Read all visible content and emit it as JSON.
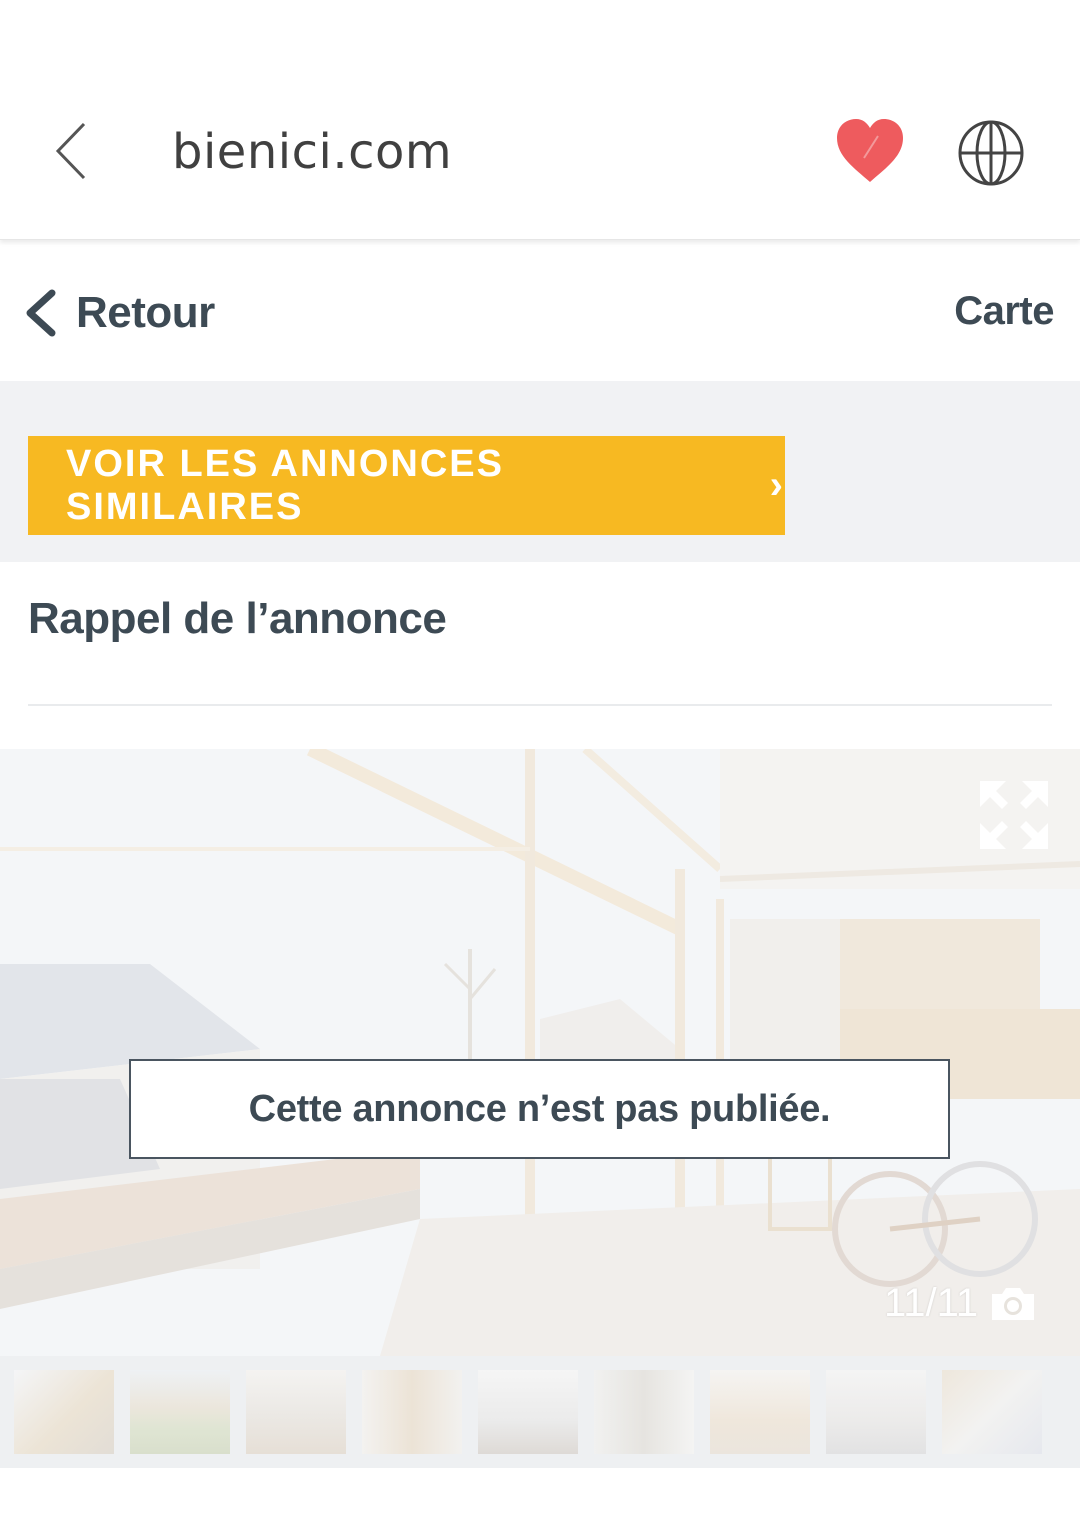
{
  "browser": {
    "title": "bienici.com"
  },
  "nav": {
    "back_label": "Retour",
    "map_label": "Carte"
  },
  "similar_button": {
    "label": "VOIR LES ANNONCES SIMILAIRES"
  },
  "section": {
    "title": "Rappel de l’annonce"
  },
  "gallery": {
    "notice": "Cette annonce n’est pas publiée.",
    "counter": "11/11",
    "thumbnail_count": 9,
    "active_index": 0
  },
  "colors": {
    "accent_yellow": "#f7b922",
    "heart_red": "#ee5b5e",
    "text_dark": "#3d4a54"
  }
}
